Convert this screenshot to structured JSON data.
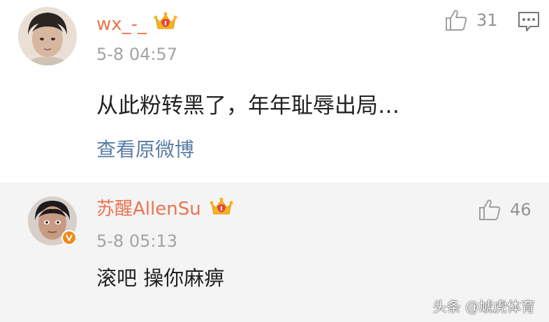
{
  "comments": [
    {
      "username": "wx_-_",
      "timestamp": "5-8 04:57",
      "content": "从此粉转黑了，年年耻辱出局…",
      "likes": "31",
      "view_original": "查看原微博"
    },
    {
      "username": "苏醒AllenSu",
      "timestamp": "5-8 05:13",
      "content": "滚吧 操你麻痹",
      "likes": "46"
    }
  ],
  "watermark": "头条 @虓虎体育",
  "colors": {
    "username": "#eb7350",
    "timestamp": "#a3a3a3",
    "link": "#5b7ea6",
    "reply_background": "#f4f4f4",
    "crown": "#f5b320",
    "verified_badge": "#f18a1c"
  },
  "icons": {
    "like": "thumbs-up-icon",
    "comment": "comment-bubble-icon",
    "crown": "crown-badge-icon",
    "verified": "verified-v-icon"
  }
}
